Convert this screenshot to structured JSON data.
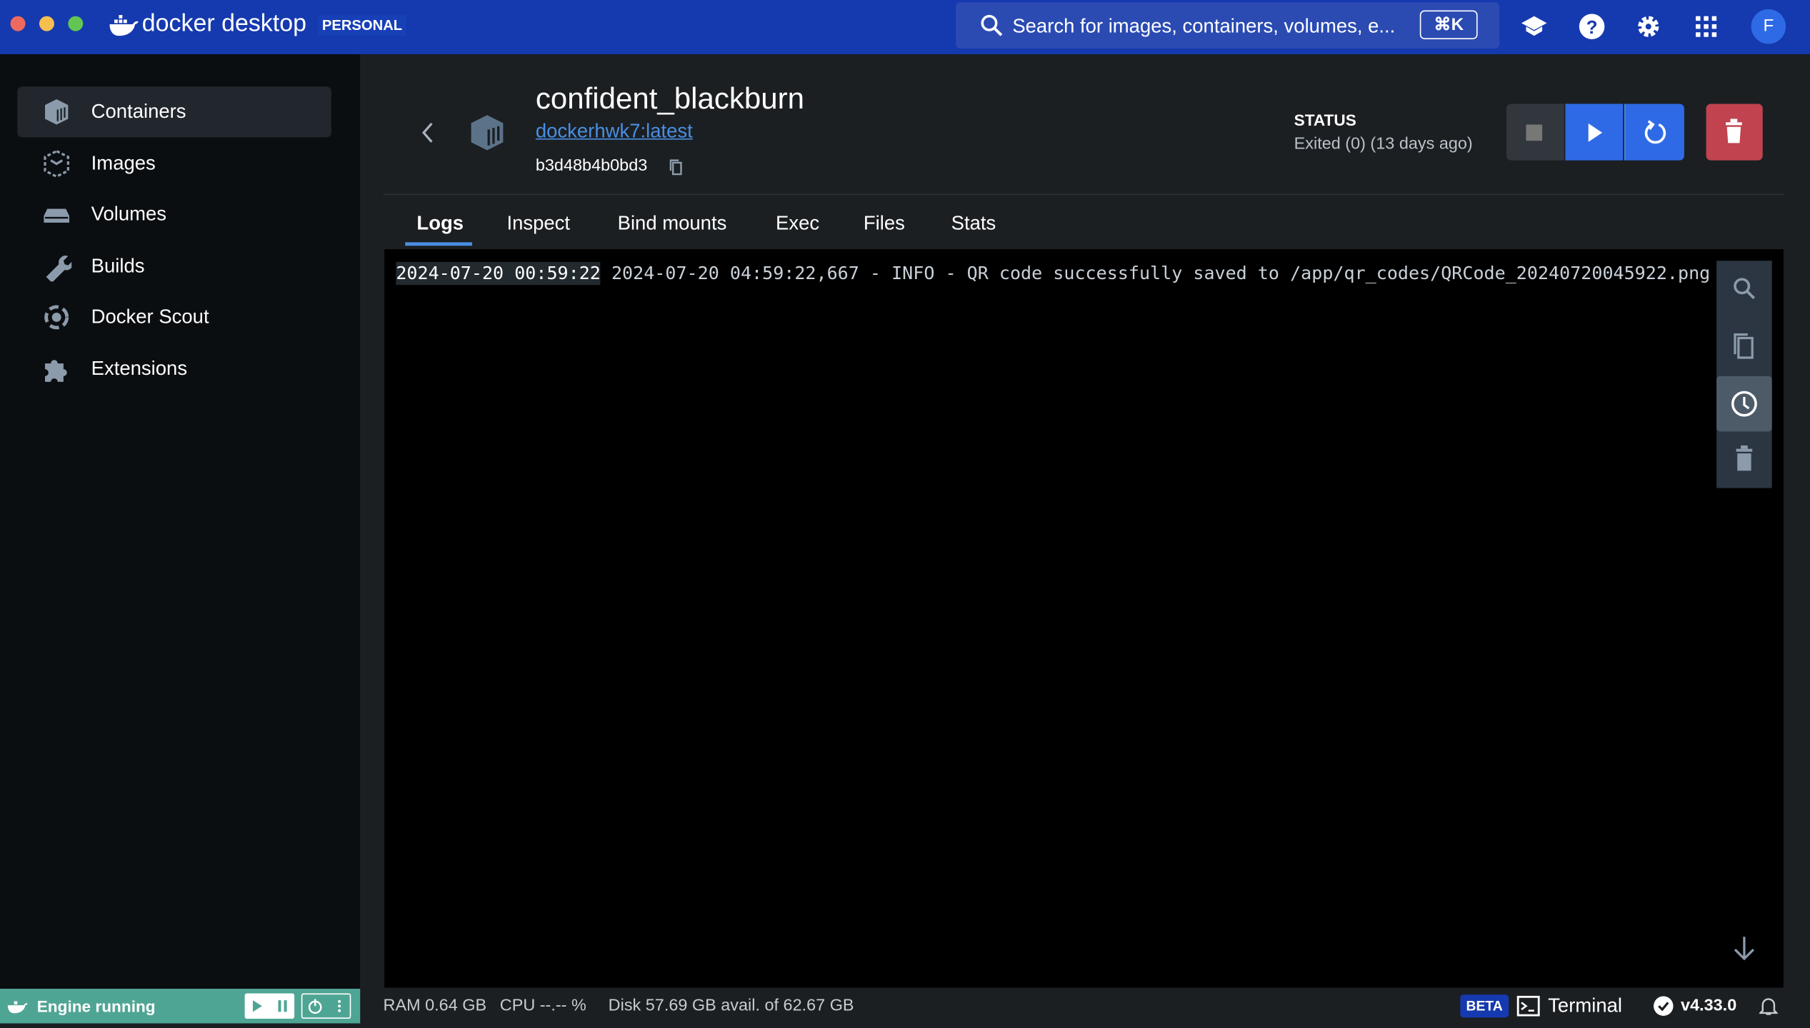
{
  "app": {
    "brand": "docker desktop",
    "plan_badge": "PERSONAL"
  },
  "search": {
    "placeholder": "Search for images, containers, volumes, e...",
    "shortcut": "⌘K"
  },
  "user": {
    "avatar_initial": "F"
  },
  "sidebar": {
    "items": [
      {
        "label": "Containers",
        "icon": "container-icon",
        "selected": true
      },
      {
        "label": "Images",
        "icon": "image-icon"
      },
      {
        "label": "Volumes",
        "icon": "volume-icon"
      },
      {
        "label": "Builds",
        "icon": "wrench-icon"
      },
      {
        "label": "Docker Scout",
        "icon": "scout-icon"
      },
      {
        "label": "Extensions",
        "icon": "puzzle-icon"
      }
    ]
  },
  "container": {
    "name": "confident_blackburn",
    "image_link": "dockerhwk7:latest",
    "id": "b3d48b4b0bd3",
    "status_label": "STATUS",
    "status_value": "Exited (0) (13 days ago)"
  },
  "tabs": [
    {
      "label": "Logs",
      "active": true
    },
    {
      "label": "Inspect"
    },
    {
      "label": "Bind mounts"
    },
    {
      "label": "Exec"
    },
    {
      "label": "Files"
    },
    {
      "label": "Stats"
    }
  ],
  "logs": [
    {
      "timestamp": "2024-07-20 00:59:22",
      "message": "2024-07-20 04:59:22,667 - INFO - QR code successfully saved to /app/qr_codes/QRCode_20240720045922.png"
    }
  ],
  "footer": {
    "engine_status": "Engine running",
    "ram": "RAM 0.64 GB",
    "cpu": "CPU --.-- %",
    "disk": "Disk 57.69 GB avail. of 62.67 GB",
    "beta_badge": "BETA",
    "terminal": "Terminal",
    "version": "v4.33.0"
  },
  "colors": {
    "topbar": "#1539ae",
    "accent": "#2f6ae6",
    "danger": "#c0434f",
    "engine": "#4fa594",
    "link": "#4a8fe3"
  }
}
